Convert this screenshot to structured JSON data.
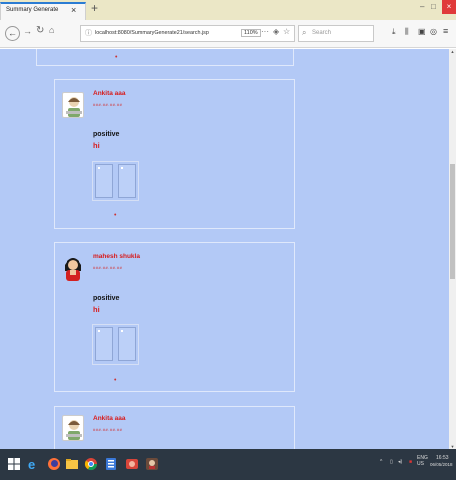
{
  "browser": {
    "tab_title": "Summary Generate",
    "tab_close": "×",
    "new_tab": "+",
    "url": "localhost:8080/SummaryGenerate21/search.jsp",
    "zoom": "110%",
    "search_placeholder": "Search",
    "window_controls": {
      "minimize": "–",
      "maximize": "□",
      "close": "×"
    }
  },
  "posts": [
    {
      "author": "Ankita aaa",
      "meta": "###.##.##.##",
      "sentiment": "positive",
      "comment": "hi",
      "avatar": "user-avatar-icon"
    },
    {
      "author": "mahesh shukla",
      "meta": "###.##.##.##",
      "sentiment": "positive",
      "comment": "hi",
      "avatar": "user-avatar-icon"
    },
    {
      "author": "Ankita aaa",
      "meta": "###.##.##.##",
      "avatar": "user-avatar-icon"
    }
  ],
  "taskbar": {
    "lang": "ENG\nUS",
    "time": "16:53",
    "date": "06/05/2018"
  },
  "colors": {
    "content_bg": "#b3c9f6",
    "author_red": "#d81b1b",
    "taskbar": "#2c3743"
  }
}
